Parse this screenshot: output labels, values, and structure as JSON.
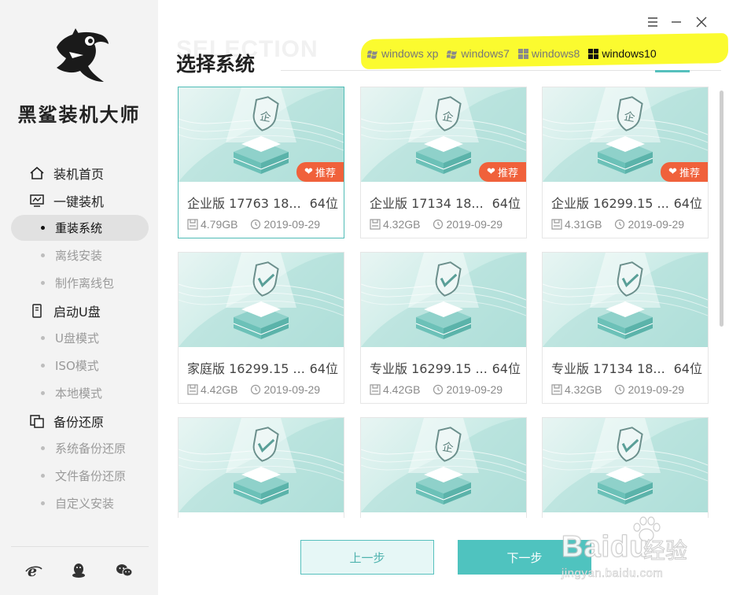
{
  "app": {
    "brand": "黑鲨装机大师",
    "watermark_title": "SELECTION"
  },
  "window_controls": {
    "menu_icon": "menu-icon",
    "minimize_icon": "minimize-icon",
    "close_icon": "close-icon"
  },
  "sidebar": {
    "sections": [
      {
        "label": "装机首页",
        "icon": "home-icon",
        "items": []
      },
      {
        "label": "一键装机",
        "icon": "monitor-icon",
        "items": [
          {
            "label": "重装系统",
            "active": true
          },
          {
            "label": "离线安装",
            "active": false
          },
          {
            "label": "制作离线包",
            "active": false
          }
        ]
      },
      {
        "label": "启动U盘",
        "icon": "usb-icon",
        "items": [
          {
            "label": "U盘模式",
            "active": false
          },
          {
            "label": "ISO模式",
            "active": false
          },
          {
            "label": "本地模式",
            "active": false
          }
        ]
      },
      {
        "label": "备份还原",
        "icon": "backup-icon",
        "items": [
          {
            "label": "系统备份还原",
            "active": false
          },
          {
            "label": "文件备份还原",
            "active": false
          },
          {
            "label": "自定义安装",
            "active": false
          }
        ]
      }
    ],
    "footer_icons": [
      "browser-icon",
      "qq-icon",
      "wechat-icon"
    ]
  },
  "main": {
    "title": "选择系统",
    "os_tabs": [
      {
        "label": "windows xp",
        "active": false
      },
      {
        "label": "windows7",
        "active": false
      },
      {
        "label": "windows8",
        "active": false
      },
      {
        "label": "windows10",
        "active": true
      }
    ],
    "cards": [
      {
        "name": "企业版 17763 18...",
        "arch": "64位",
        "size": "4.79GB",
        "date": "2019-09-29",
        "recommended": true,
        "badge": "推荐",
        "selected": true,
        "shield": "企"
      },
      {
        "name": "企业版 17134 18...",
        "arch": "64位",
        "size": "4.32GB",
        "date": "2019-09-29",
        "recommended": true,
        "badge": "推荐",
        "selected": false,
        "shield": "企"
      },
      {
        "name": "企业版 16299.15 ...",
        "arch": "64位",
        "size": "4.31GB",
        "date": "2019-09-29",
        "recommended": true,
        "badge": "推荐",
        "selected": false,
        "shield": "企"
      },
      {
        "name": "家庭版 16299.15 ...",
        "arch": "64位",
        "size": "4.42GB",
        "date": "2019-09-29",
        "recommended": false,
        "badge": "",
        "selected": false,
        "shield": "check"
      },
      {
        "name": "专业版 16299.15 ...",
        "arch": "64位",
        "size": "4.42GB",
        "date": "2019-09-29",
        "recommended": false,
        "badge": "",
        "selected": false,
        "shield": "check"
      },
      {
        "name": "专业版 17134 18...",
        "arch": "64位",
        "size": "4.32GB",
        "date": "2019-09-29",
        "recommended": false,
        "badge": "",
        "selected": false,
        "shield": "check"
      },
      {
        "name": "",
        "arch": "",
        "size": "",
        "date": "",
        "recommended": false,
        "badge": "",
        "selected": false,
        "shield": "check"
      },
      {
        "name": "",
        "arch": "",
        "size": "",
        "date": "",
        "recommended": false,
        "badge": "",
        "selected": false,
        "shield": "企"
      },
      {
        "name": "",
        "arch": "",
        "size": "",
        "date": "",
        "recommended": false,
        "badge": "",
        "selected": false,
        "shield": "check"
      }
    ],
    "prev_button": "上一步",
    "next_button": "下一步"
  },
  "watermark": {
    "logo": "Bai",
    "logo2": "du",
    "cn": "经验",
    "url": "jingyan.baidu.com"
  },
  "colors": {
    "accent": "#4fc3bf",
    "badge": "#f0613b",
    "highlight": "#fbfb2f"
  }
}
